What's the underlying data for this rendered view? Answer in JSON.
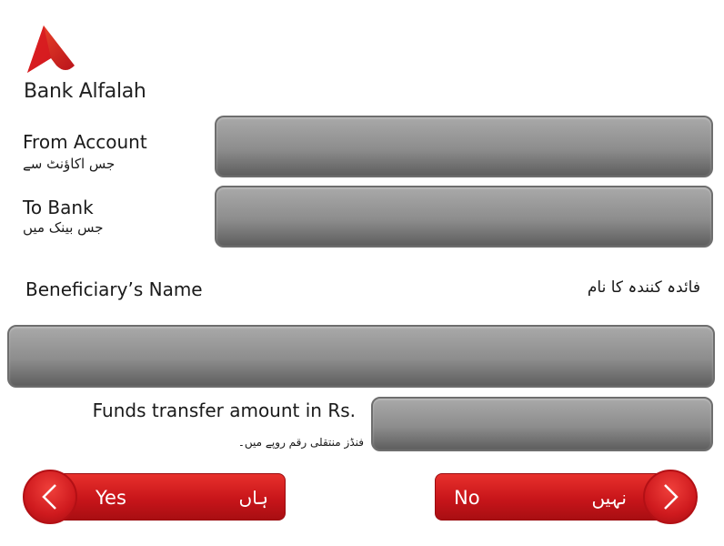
{
  "brand": {
    "name": "Bank Alfalah"
  },
  "fields": {
    "from_account": {
      "label_en": "From Account",
      "label_ur": "جس اکاؤنٹ سے",
      "value": ""
    },
    "to_bank": {
      "label_en": "To Bank",
      "label_ur": "جس بینک میں",
      "value": ""
    },
    "beneficiary_name": {
      "label_en": "Beneficiary’s Name",
      "label_ur": "فائدہ کنندہ کا نام",
      "value": ""
    },
    "amount": {
      "label_en": "Funds transfer amount in Rs.",
      "label_ur": "فنڈز منتقلی رقم روپے میں۔",
      "value": ""
    }
  },
  "buttons": {
    "yes": {
      "label_en": "Yes",
      "label_ur": "ہاں"
    },
    "no": {
      "label_en": "No",
      "label_ur": "نہیں"
    }
  },
  "colors": {
    "accent": "#d71920",
    "field": "#8d8d8d"
  },
  "icons": {
    "logo": "alfalah-logo-icon",
    "yes": "chevron-left-icon",
    "no": "chevron-right-icon"
  }
}
